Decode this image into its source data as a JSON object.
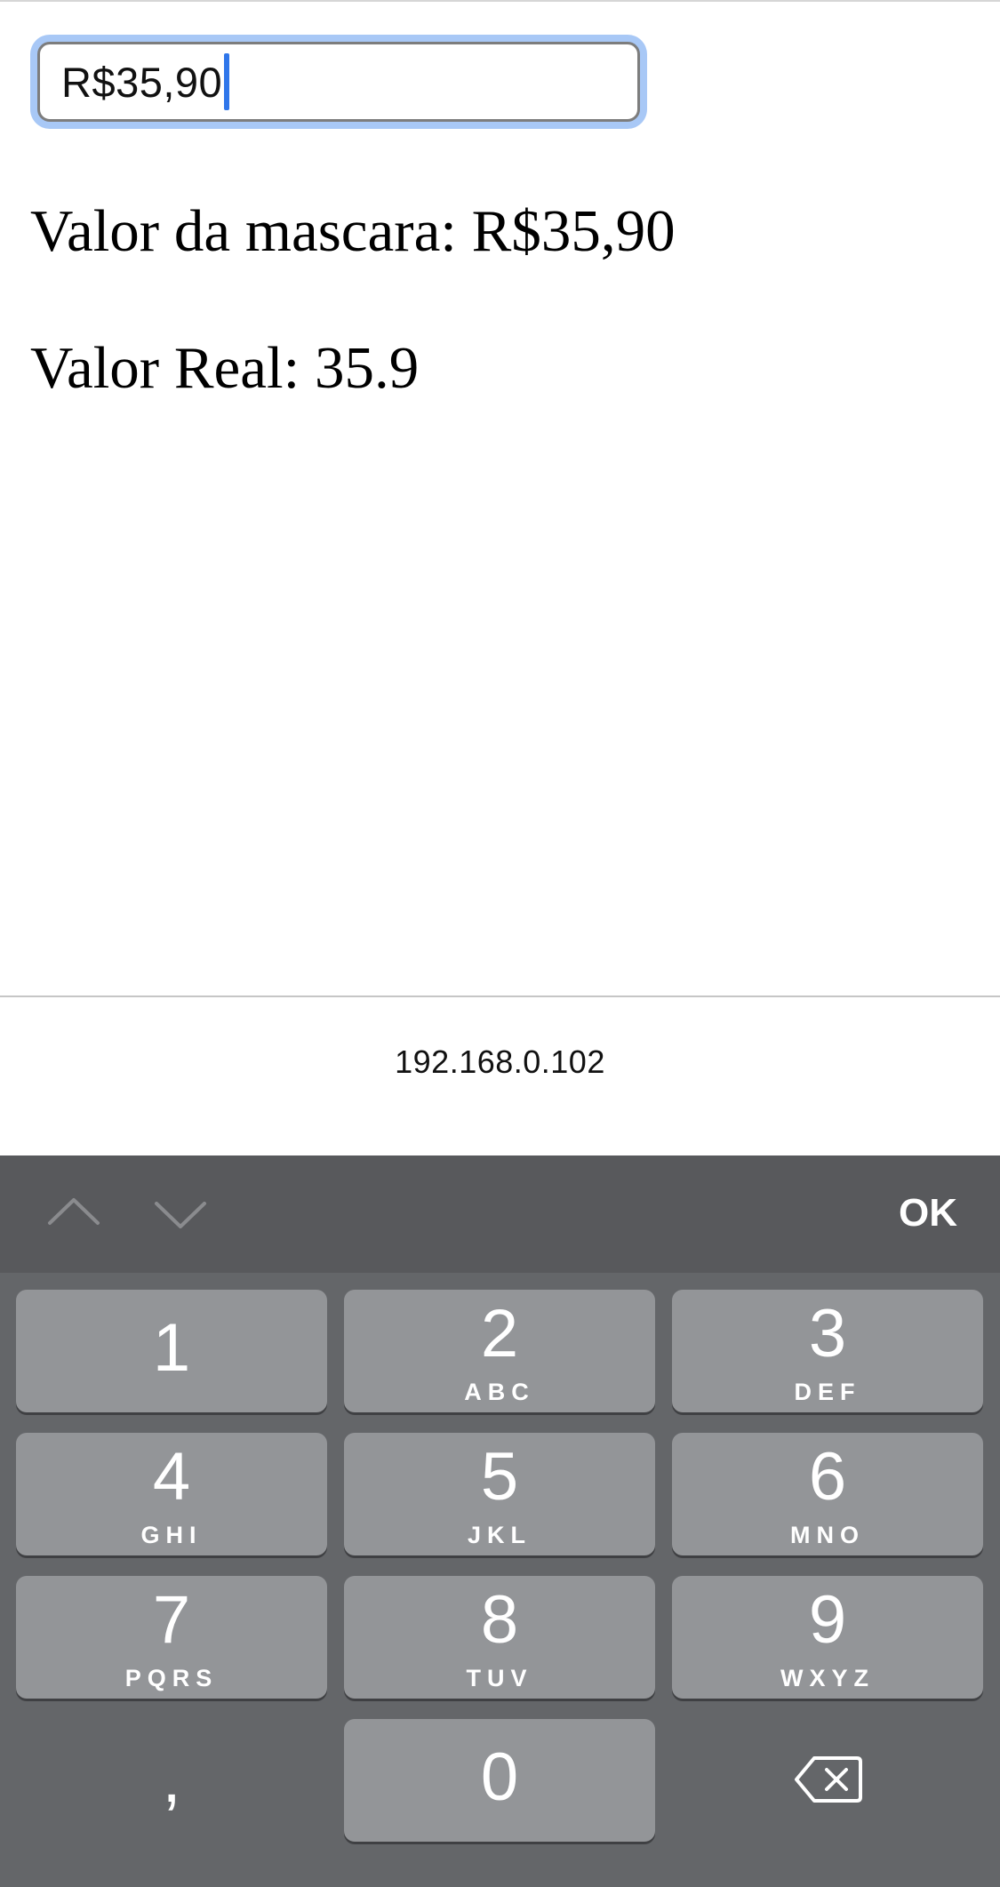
{
  "page": {
    "input_value": "R$35,90",
    "mask_label": "Valor da mascara: R$35,90",
    "real_label": "Valor Real: 35.9"
  },
  "browser": {
    "address": "192.168.0.102"
  },
  "toolbar": {
    "ok_label": "OK",
    "prev_icon": "chevron-up-icon",
    "next_icon": "chevron-down-icon"
  },
  "keypad": {
    "keys": [
      {
        "digit": "1",
        "letters": ""
      },
      {
        "digit": "2",
        "letters": "ABC"
      },
      {
        "digit": "3",
        "letters": "DEF"
      },
      {
        "digit": "4",
        "letters": "GHI"
      },
      {
        "digit": "5",
        "letters": "JKL"
      },
      {
        "digit": "6",
        "letters": "MNO"
      },
      {
        "digit": "7",
        "letters": "PQRS"
      },
      {
        "digit": "8",
        "letters": "TUV"
      },
      {
        "digit": "9",
        "letters": "WXYZ"
      }
    ],
    "comma": ",",
    "zero": "0",
    "backspace_icon": "backspace-icon"
  },
  "colors": {
    "focus_ring": "#a8c8f6",
    "caret": "#2f76ea",
    "keyboard_bg": "#646669",
    "key_bg": "#939598",
    "toolbar_bg": "#58595c"
  }
}
